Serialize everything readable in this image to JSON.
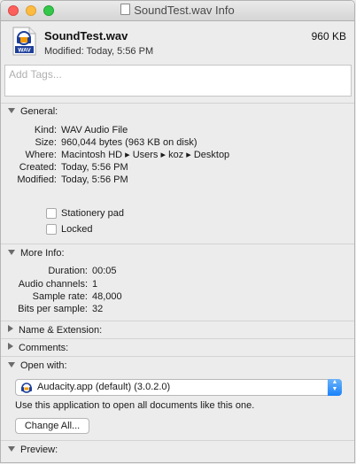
{
  "window": {
    "title": "SoundTest.wav Info"
  },
  "header": {
    "file_name": "SoundTest.wav",
    "file_size": "960 KB",
    "modified_line": "Modified: Today, 5:56 PM",
    "icon_text": "WAV"
  },
  "tags": {
    "placeholder": "Add Tags..."
  },
  "general": {
    "title": "General:",
    "rows": [
      {
        "label": "Kind:",
        "value": "WAV Audio File"
      },
      {
        "label": "Size:",
        "value": "960,044 bytes (963 KB on disk)"
      },
      {
        "label": "Where:",
        "value": "Macintosh HD ▸ Users ▸ koz ▸ Desktop"
      },
      {
        "label": "Created:",
        "value": "Today, 5:56 PM"
      },
      {
        "label": "Modified:",
        "value": "Today, 5:56 PM"
      }
    ],
    "stationery_label": "Stationery pad",
    "locked_label": "Locked"
  },
  "more_info": {
    "title": "More Info:",
    "rows": [
      {
        "label": "Duration:",
        "value": "00:05"
      },
      {
        "label": "Audio channels:",
        "value": "1"
      },
      {
        "label": "Sample rate:",
        "value": "48,000"
      },
      {
        "label": "Bits per sample:",
        "value": "32"
      }
    ]
  },
  "name_ext": {
    "title": "Name & Extension:"
  },
  "comments": {
    "title": "Comments:"
  },
  "open_with": {
    "title": "Open with:",
    "selected_app": "Audacity.app (default) (3.0.2.0)",
    "hint": "Use this application to open all documents like this one.",
    "change_all_label": "Change All..."
  },
  "preview": {
    "title": "Preview:"
  },
  "colors": {
    "accent": "#1a82fb",
    "close": "#fc605c",
    "minimize": "#fdbc40",
    "zoom": "#34c84a"
  },
  "icons": [
    "wav-file-icon",
    "audacity-icon",
    "disclosure-triangle-icon"
  ]
}
